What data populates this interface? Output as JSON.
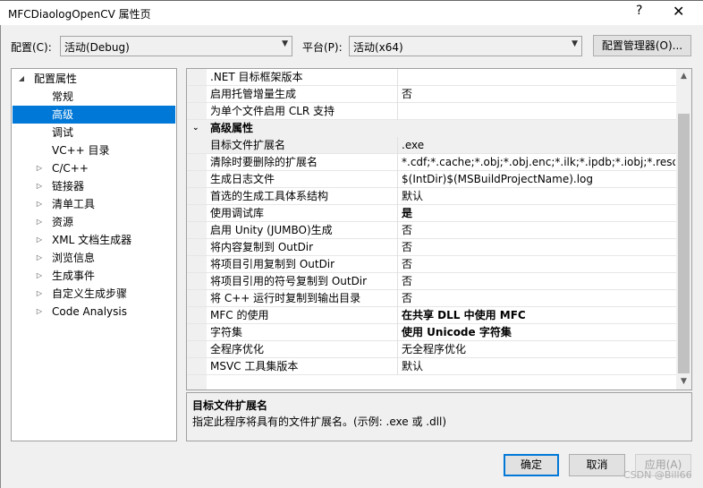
{
  "window": {
    "title": "MFCDiaologOpenCV 属性页",
    "help_label": "?",
    "close_label": "✕"
  },
  "config": {
    "config_label": "配置(C):",
    "config_value": "活动(Debug)",
    "platform_label": "平台(P):",
    "platform_value": "活动(x64)",
    "manager_label": "配置管理器(O)..."
  },
  "tree": {
    "items": [
      {
        "label": "配置属性",
        "expander": "◢",
        "level": 0
      },
      {
        "label": "常规",
        "expander": "",
        "level": 1
      },
      {
        "label": "高级",
        "expander": "",
        "level": 1,
        "selected": true
      },
      {
        "label": "调试",
        "expander": "",
        "level": 1
      },
      {
        "label": "VC++ 目录",
        "expander": "",
        "level": 1
      },
      {
        "label": "C/C++",
        "expander": "▷",
        "level": 1
      },
      {
        "label": "链接器",
        "expander": "▷",
        "level": 1
      },
      {
        "label": "清单工具",
        "expander": "▷",
        "level": 1
      },
      {
        "label": "资源",
        "expander": "▷",
        "level": 1
      },
      {
        "label": "XML 文档生成器",
        "expander": "▷",
        "level": 1
      },
      {
        "label": "浏览信息",
        "expander": "▷",
        "level": 1
      },
      {
        "label": "生成事件",
        "expander": "▷",
        "level": 1
      },
      {
        "label": "自定义生成步骤",
        "expander": "▷",
        "level": 1
      },
      {
        "label": "Code Analysis",
        "expander": "▷",
        "level": 1
      }
    ]
  },
  "grid": {
    "rows": [
      {
        "kind": "prop",
        "name": ".NET 目标框架版本",
        "value": ""
      },
      {
        "kind": "prop",
        "name": "启用托管增量生成",
        "value": "否"
      },
      {
        "kind": "prop",
        "name": "为单个文件启用 CLR 支持",
        "value": ""
      },
      {
        "kind": "cat",
        "name": "高级属性",
        "expander": "⌄"
      },
      {
        "kind": "prop",
        "name": "目标文件扩展名",
        "value": ".exe",
        "selected": true
      },
      {
        "kind": "prop",
        "name": "清除时要删除的扩展名",
        "value": "*.cdf;*.cache;*.obj;*.obj.enc;*.ilk;*.ipdb;*.iobj;*.resources"
      },
      {
        "kind": "prop",
        "name": "生成日志文件",
        "value": "$(IntDir)$(MSBuildProjectName).log"
      },
      {
        "kind": "prop",
        "name": "首选的生成工具体系结构",
        "value": "默认"
      },
      {
        "kind": "prop",
        "name": "使用调试库",
        "value": "是",
        "bold": true
      },
      {
        "kind": "prop",
        "name": "启用 Unity (JUMBO)生成",
        "value": "否"
      },
      {
        "kind": "prop",
        "name": "将内容复制到 OutDir",
        "value": "否"
      },
      {
        "kind": "prop",
        "name": "将项目引用复制到 OutDir",
        "value": "否"
      },
      {
        "kind": "prop",
        "name": "将项目引用的符号复制到 OutDir",
        "value": "否"
      },
      {
        "kind": "prop",
        "name": "将 C++ 运行时复制到输出目录",
        "value": "否"
      },
      {
        "kind": "prop",
        "name": "MFC 的使用",
        "value": "在共享 DLL 中使用 MFC",
        "bold": true
      },
      {
        "kind": "prop",
        "name": "字符集",
        "value": "使用 Unicode 字符集",
        "bold": true
      },
      {
        "kind": "prop",
        "name": "全程序优化",
        "value": "无全程序优化"
      },
      {
        "kind": "prop",
        "name": "MSVC 工具集版本",
        "value": "默认"
      }
    ],
    "scroll_up": "▲",
    "scroll_down": "▼"
  },
  "description": {
    "title": "目标文件扩展名",
    "text": "指定此程序将具有的文件扩展名。(示例: .exe 或 .dll)"
  },
  "buttons": {
    "ok": "确定",
    "cancel": "取消",
    "apply": "应用(A)"
  },
  "watermark": "CSDN @Bill66",
  "colors": {
    "accent": "#0078d7",
    "window_bg": "#f0f0f0"
  }
}
